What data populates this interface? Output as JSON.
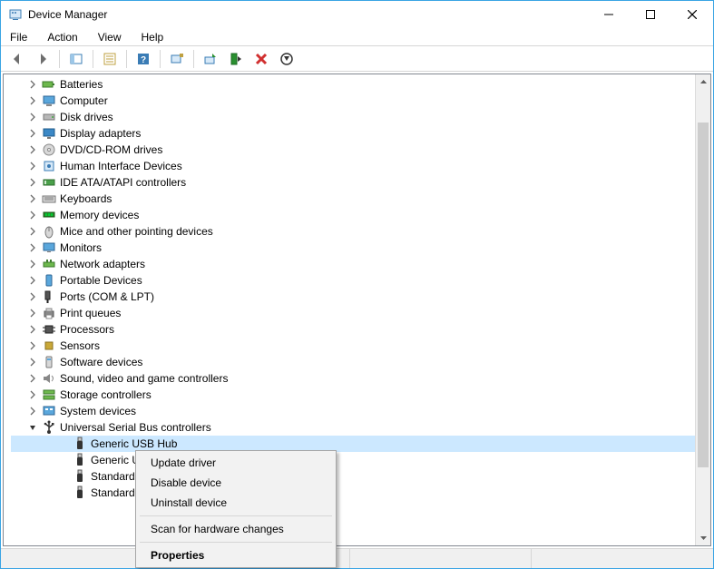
{
  "window": {
    "title": "Device Manager"
  },
  "menubar": {
    "items": [
      "File",
      "Action",
      "View",
      "Help"
    ]
  },
  "tree": {
    "categories": [
      {
        "label": "Batteries",
        "icon": "battery"
      },
      {
        "label": "Computer",
        "icon": "computer"
      },
      {
        "label": "Disk drives",
        "icon": "disk"
      },
      {
        "label": "Display adapters",
        "icon": "display"
      },
      {
        "label": "DVD/CD-ROM drives",
        "icon": "dvd"
      },
      {
        "label": "Human Interface Devices",
        "icon": "hid"
      },
      {
        "label": "IDE ATA/ATAPI controllers",
        "icon": "ide"
      },
      {
        "label": "Keyboards",
        "icon": "keyboard"
      },
      {
        "label": "Memory devices",
        "icon": "memory"
      },
      {
        "label": "Mice and other pointing devices",
        "icon": "mouse"
      },
      {
        "label": "Monitors",
        "icon": "monitor"
      },
      {
        "label": "Network adapters",
        "icon": "network"
      },
      {
        "label": "Portable Devices",
        "icon": "portable"
      },
      {
        "label": "Ports (COM & LPT)",
        "icon": "ports"
      },
      {
        "label": "Print queues",
        "icon": "printer"
      },
      {
        "label": "Processors",
        "icon": "cpu"
      },
      {
        "label": "Sensors",
        "icon": "sensor"
      },
      {
        "label": "Software devices",
        "icon": "software"
      },
      {
        "label": "Sound, video and game controllers",
        "icon": "sound"
      },
      {
        "label": "Storage controllers",
        "icon": "storage"
      },
      {
        "label": "System devices",
        "icon": "system"
      }
    ],
    "usb": {
      "label": "Universal Serial Bus controllers",
      "children": [
        {
          "label": "Generic USB Hub",
          "selected": true
        },
        {
          "label": "Generic U"
        },
        {
          "label": "Standard"
        },
        {
          "label": "Standard"
        }
      ]
    }
  },
  "context_menu": {
    "items": [
      {
        "label": "Update driver"
      },
      {
        "label": "Disable device"
      },
      {
        "label": "Uninstall device"
      },
      {
        "sep": true
      },
      {
        "label": "Scan for hardware changes"
      },
      {
        "sep": true
      },
      {
        "label": "Properties",
        "bold": true
      }
    ]
  }
}
